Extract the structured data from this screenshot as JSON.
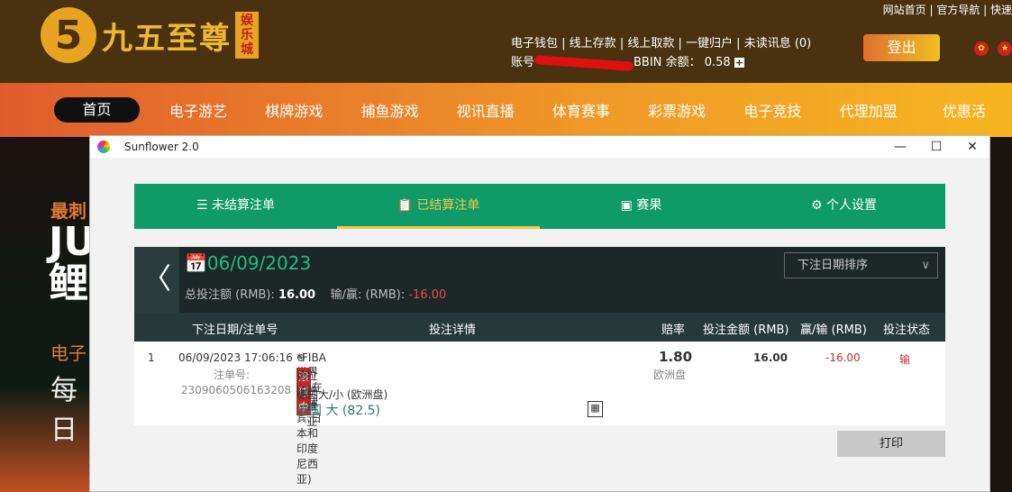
{
  "site": {
    "logo_num": "5",
    "logo_name": "九五至尊",
    "logo_tag": "娱乐城",
    "top_links": "网站首页 | 官方导航 | 快速",
    "account_links": [
      "电子钱包",
      "线上存款",
      "线上取款",
      "一键归户",
      "未读讯息 (0)"
    ],
    "account_label": "账号",
    "account_suffix": "BBIN",
    "balance_label": "余额：",
    "balance": "0.58",
    "logout": "登出",
    "nav": [
      "首页",
      "电子游艺",
      "棋牌游戏",
      "捕鱼游戏",
      "视讯直播",
      "体育赛事",
      "彩票游戏",
      "电子竞技",
      "代理加盟",
      "优惠活"
    ],
    "banner": [
      "最刺",
      "JU",
      "鲤",
      "电子",
      "每日"
    ]
  },
  "window": {
    "title": "Sunflower 2.0",
    "min": "—",
    "max": "☐",
    "close": "✕"
  },
  "tabs": [
    "未结算注单",
    "已结算注单",
    "赛果",
    "个人设置"
  ],
  "summary": {
    "date": "06/09/2023",
    "total_label": "总投注额 (RMB):",
    "total": "16.00",
    "pl_label": "输/赢: (RMB):",
    "pl": "-16.00",
    "sort": "下注日期排序"
  },
  "table": {
    "headers": [
      "下注日期/注单号",
      "投注详情",
      "赔率",
      "投注金额 (RMB)",
      "赢/输 (RMB)",
      "投注状态"
    ],
    "rows": [
      {
        "n": "1",
        "datetime": "06/09/2023 17:06:16",
        "id_label": "注单号:",
        "id": "2309060506163208",
        "league": "*FIBA世界杯(在菲律宾,日本和印度尼西亚)",
        "live": "滚球中",
        "home": "德国",
        "vs": "vs",
        "away": "拉脱维亚",
        "market": "德国大/小 (欧洲盘)",
        "pick": "德国 大 (82.5)",
        "odds": "1.80",
        "odds_type": "欧洲盘",
        "stake": "16.00",
        "pl": "-16.00",
        "status": "输"
      }
    ]
  },
  "print": "打印"
}
